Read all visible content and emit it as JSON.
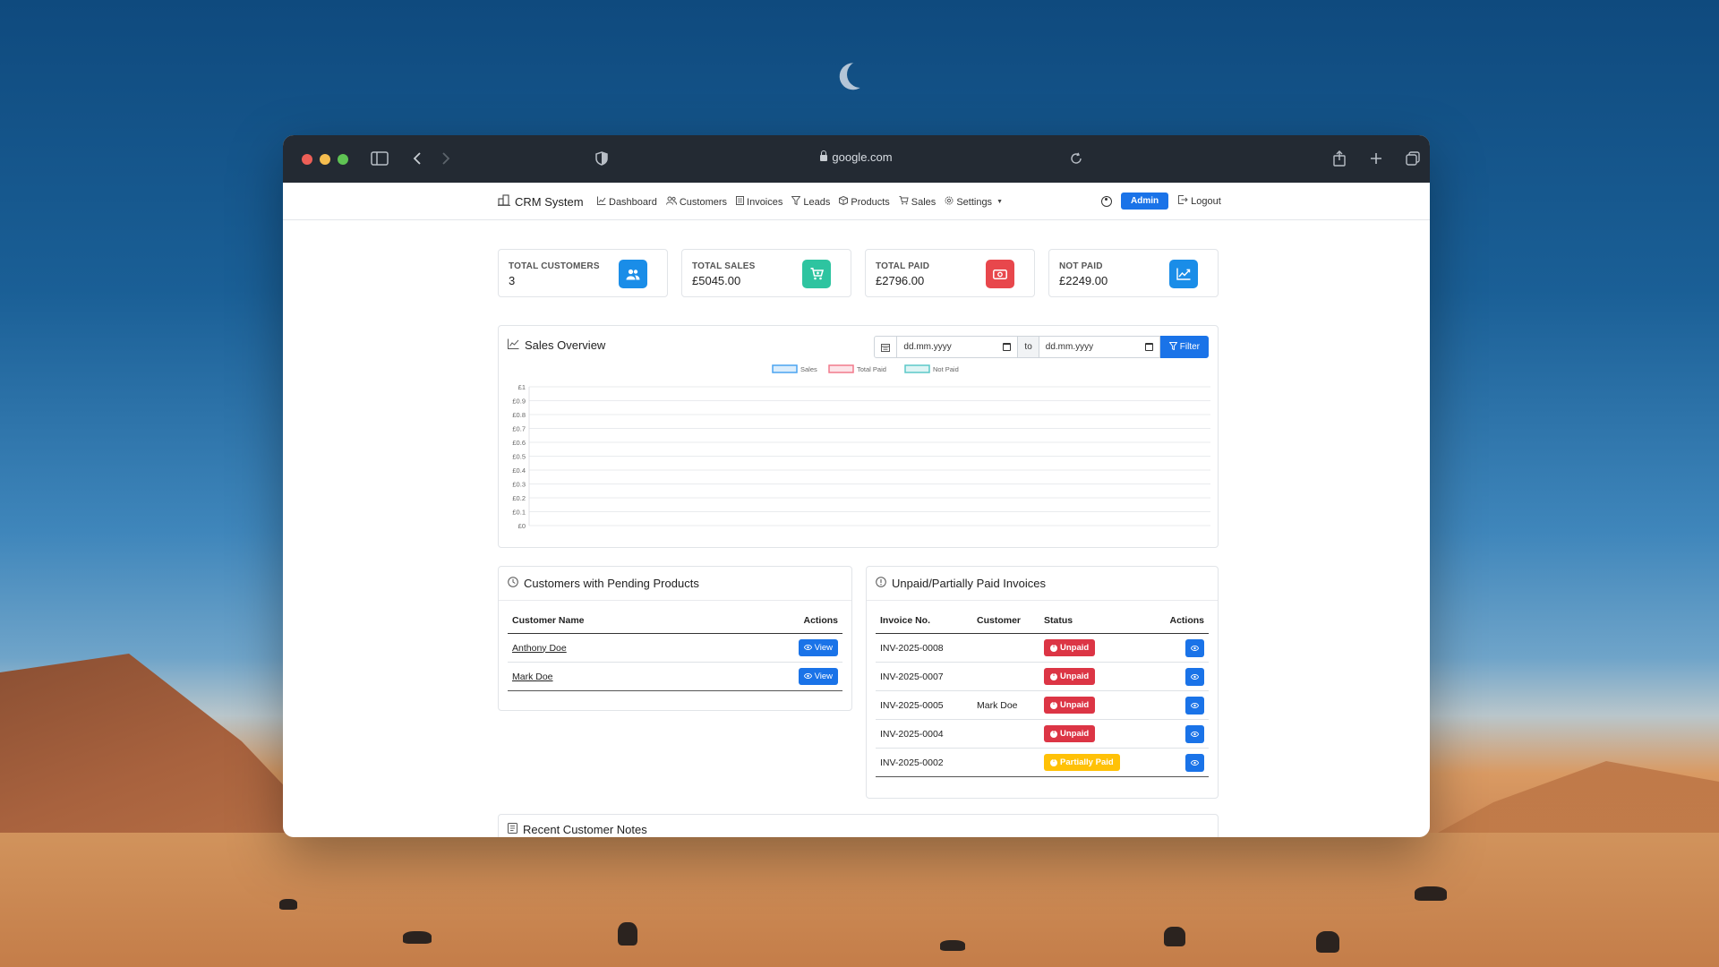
{
  "browser": {
    "url": "google.com"
  },
  "navbar": {
    "brand": "CRM System",
    "items": [
      {
        "label": "Dashboard",
        "icon": "chart-line-icon"
      },
      {
        "label": "Customers",
        "icon": "people-icon"
      },
      {
        "label": "Invoices",
        "icon": "receipt-icon"
      },
      {
        "label": "Leads",
        "icon": "funnel-icon"
      },
      {
        "label": "Products",
        "icon": "box-icon"
      },
      {
        "label": "Sales",
        "icon": "cart-icon"
      },
      {
        "label": "Settings",
        "icon": "gear-icon"
      }
    ],
    "user_badge": "Admin",
    "logout": "Logout"
  },
  "stats": [
    {
      "label": "TOTAL CUSTOMERS",
      "value": "3",
      "icon": "people-icon",
      "color": "#1a8de8"
    },
    {
      "label": "TOTAL SALES",
      "value": "£5045.00",
      "icon": "cart-icon",
      "color": "#2ec4a0"
    },
    {
      "label": "TOTAL PAID",
      "value": "£2796.00",
      "icon": "cash-icon",
      "color": "#e8474c"
    },
    {
      "label": "NOT PAID",
      "value": "£2249.00",
      "icon": "graph-up-icon",
      "color": "#1a8de8"
    }
  ],
  "sales_overview": {
    "title": "Sales Overview",
    "date_from_placeholder": "dd.mm.yyyy",
    "to_label": "to",
    "date_to_placeholder": "dd.mm.yyyy",
    "filter_label": "Filter"
  },
  "chart_data": {
    "type": "line",
    "title": "",
    "xlabel": "",
    "ylabel": "",
    "ylim": [
      0,
      1
    ],
    "y_ticks": [
      "£0",
      "£0.1",
      "£0.2",
      "£0.3",
      "£0.4",
      "£0.5",
      "£0.6",
      "£0.7",
      "£0.8",
      "£0.9",
      "£1"
    ],
    "x": [],
    "series": [
      {
        "name": "Sales",
        "values": [],
        "color": "#4aa3f0"
      },
      {
        "name": "Total Paid",
        "values": [],
        "color": "#f27a8c"
      },
      {
        "name": "Not Paid",
        "values": [],
        "color": "#5cc8c8"
      }
    ],
    "grid": true,
    "legend": "top-center"
  },
  "pending": {
    "title": "Customers with Pending Products",
    "col_name": "Customer Name",
    "col_actions": "Actions",
    "rows": [
      {
        "name": "Anthony Doe",
        "action": "View"
      },
      {
        "name": "Mark Doe",
        "action": "View"
      }
    ]
  },
  "invoices": {
    "title": "Unpaid/Partially Paid Invoices",
    "col_no": "Invoice No.",
    "col_customer": "Customer",
    "col_status": "Status",
    "col_actions": "Actions",
    "rows": [
      {
        "no": "INV-2025-0008",
        "customer": "",
        "status": "Unpaid",
        "kind": "unpaid"
      },
      {
        "no": "INV-2025-0007",
        "customer": "",
        "status": "Unpaid",
        "kind": "unpaid"
      },
      {
        "no": "INV-2025-0005",
        "customer": "Mark Doe",
        "status": "Unpaid",
        "kind": "unpaid"
      },
      {
        "no": "INV-2025-0004",
        "customer": "",
        "status": "Unpaid",
        "kind": "unpaid"
      },
      {
        "no": "INV-2025-0002",
        "customer": "",
        "status": "Partially Paid",
        "kind": "partial"
      }
    ]
  },
  "notes": {
    "title": "Recent Customer Notes"
  }
}
